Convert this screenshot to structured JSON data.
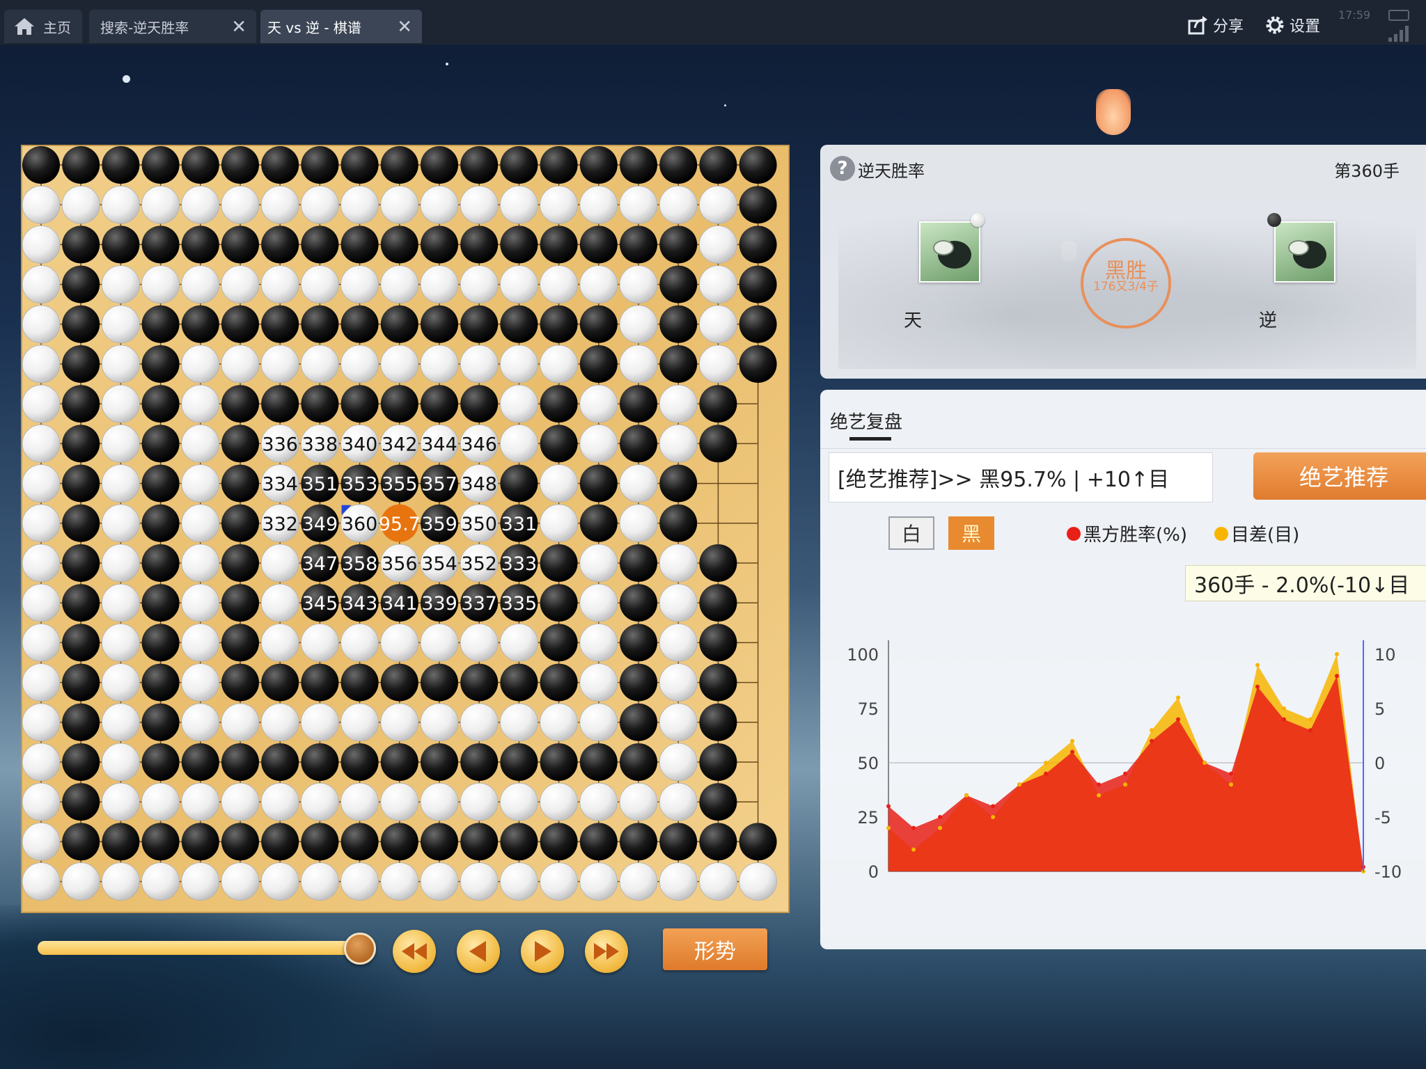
{
  "tabs": {
    "home": "主页",
    "search": "搜索-逆天胜率",
    "game": "天 vs 逆 - 棋谱",
    "close_symbol": "✕"
  },
  "topbar": {
    "share": "分享",
    "settings": "设置",
    "time": "17:59"
  },
  "board": {
    "size": 19,
    "legend": "Each string is one row from top to bottom; B = black stone, W = white stone",
    "rows": [
      "BBBBBBBBBBBBBBBBBBB",
      "WWWWWWWWWWWWWWWWWWB",
      "WBBBBBBBBBBBBBBBBWB",
      "WBWWWWWWWWWWWWWWBWB",
      "WBWBBBBBBBBBBBBWBWB",
      "WBWBWWWWWWWWWWBWBWB",
      "WBWBWBBBBBBBWBWBWB",
      "WBWBWBWWWWWBWBWBWB",
      "WBWBWBWBBBBWBWBWB",
      "WBWBWBWBWWBWBWBWB",
      "WBWBWBWBBBBBWBWBWB",
      "WBWBWBWBBBBBWBWBWB",
      "WBWBWBWWWWWWWBWBWB",
      "WBWBWBBBBBBBBBWBWB",
      "WBWBWWWWWWWWWWWBWB",
      "WBWBBBBBBBBBBBBBWB",
      "WBWWWWWWWWWWWWWWWB",
      "WBBBBBBBBBBBBBBBBBB",
      "WWWWWWWWWWWWWWWWWWW"
    ],
    "numbered_stones": [
      {
        "col": 6,
        "row": 7,
        "color": "W",
        "label": "336"
      },
      {
        "col": 7,
        "row": 7,
        "color": "W",
        "label": "338"
      },
      {
        "col": 8,
        "row": 7,
        "color": "W",
        "label": "340"
      },
      {
        "col": 9,
        "row": 7,
        "color": "W",
        "label": "342"
      },
      {
        "col": 10,
        "row": 7,
        "color": "W",
        "label": "344"
      },
      {
        "col": 11,
        "row": 7,
        "color": "W",
        "label": "346"
      },
      {
        "col": 6,
        "row": 8,
        "color": "W",
        "label": "334"
      },
      {
        "col": 7,
        "row": 8,
        "color": "B",
        "label": "351"
      },
      {
        "col": 8,
        "row": 8,
        "color": "B",
        "label": "353"
      },
      {
        "col": 9,
        "row": 8,
        "color": "B",
        "label": "355"
      },
      {
        "col": 10,
        "row": 8,
        "color": "B",
        "label": "357"
      },
      {
        "col": 11,
        "row": 8,
        "color": "W",
        "label": "348"
      },
      {
        "col": 6,
        "row": 9,
        "color": "W",
        "label": "332"
      },
      {
        "col": 7,
        "row": 9,
        "color": "B",
        "label": "349"
      },
      {
        "col": 8,
        "row": 9,
        "color": "W",
        "label": "360"
      },
      {
        "col": 9,
        "row": 9,
        "color": "O",
        "label": "95.7"
      },
      {
        "col": 10,
        "row": 9,
        "color": "B",
        "label": "359"
      },
      {
        "col": 11,
        "row": 9,
        "color": "W",
        "label": "350"
      },
      {
        "col": 12,
        "row": 9,
        "color": "B",
        "label": "331"
      },
      {
        "col": 7,
        "row": 10,
        "color": "B",
        "label": "347"
      },
      {
        "col": 8,
        "row": 10,
        "color": "B",
        "label": "358"
      },
      {
        "col": 9,
        "row": 10,
        "color": "W",
        "label": "356"
      },
      {
        "col": 10,
        "row": 10,
        "color": "W",
        "label": "354"
      },
      {
        "col": 11,
        "row": 10,
        "color": "W",
        "label": "352"
      },
      {
        "col": 12,
        "row": 10,
        "color": "B",
        "label": "333"
      },
      {
        "col": 7,
        "row": 11,
        "color": "B",
        "label": "345"
      },
      {
        "col": 8,
        "row": 11,
        "color": "B",
        "label": "343"
      },
      {
        "col": 9,
        "row": 11,
        "color": "B",
        "label": "341"
      },
      {
        "col": 10,
        "row": 11,
        "color": "B",
        "label": "339"
      },
      {
        "col": 11,
        "row": 11,
        "color": "B",
        "label": "337"
      },
      {
        "col": 12,
        "row": 11,
        "color": "B",
        "label": "335"
      }
    ],
    "last_move_marker": {
      "col": 8,
      "row": 9
    }
  },
  "controls": {
    "progress": 1.0,
    "situation": "形势",
    "buttons": [
      "fast-backward",
      "step-backward",
      "step-forward",
      "fast-forward"
    ]
  },
  "panel": {
    "title": "逆天胜率",
    "help": "?",
    "move_number": "第360手",
    "black_name": "天",
    "white_name": "逆",
    "result_main": "黑胜",
    "result_sub": "176又3/4子"
  },
  "analysis": {
    "tab": "绝艺复盘",
    "recommend_text": "[绝艺推荐]>> 黑95.7% | +10↑目",
    "recommend_button": "绝艺推荐",
    "white_button": "白",
    "black_button": "黑",
    "legend_winrate": "黑方胜率(%)",
    "legend_diff": "目差(目)",
    "tooltip": "360手 - 2.0%(-10↓目"
  },
  "colors": {
    "winrate": "#e82018",
    "diff": "#f7b500",
    "accent": "#e88a30"
  },
  "chart_data": {
    "type": "area",
    "title": "",
    "x_range": [
      1,
      360
    ],
    "left_axis": {
      "ticks": [
        0,
        25,
        50,
        75,
        100
      ],
      "ylim": [
        0,
        100
      ]
    },
    "right_axis": {
      "ticks": [
        -10,
        -5,
        0,
        5,
        10
      ],
      "ylim": [
        -10,
        10
      ]
    },
    "series": [
      {
        "name": "黑方胜率(%)",
        "color": "#e82018",
        "x": [
          1,
          20,
          40,
          60,
          80,
          100,
          120,
          140,
          160,
          180,
          200,
          220,
          240,
          260,
          280,
          300,
          320,
          340,
          360
        ],
        "values": [
          30,
          20,
          25,
          35,
          30,
          40,
          45,
          55,
          40,
          45,
          60,
          70,
          50,
          45,
          85,
          70,
          65,
          90,
          2
        ]
      },
      {
        "name": "目差(目)",
        "color": "#f7b500",
        "x": [
          1,
          20,
          40,
          60,
          80,
          100,
          120,
          140,
          160,
          180,
          200,
          220,
          240,
          260,
          280,
          300,
          320,
          340,
          360
        ],
        "values": [
          -6,
          -8,
          -6,
          -3,
          -5,
          -2,
          0,
          2,
          -3,
          -2,
          3,
          6,
          0,
          -2,
          9,
          5,
          4,
          10,
          -10
        ]
      }
    ]
  }
}
